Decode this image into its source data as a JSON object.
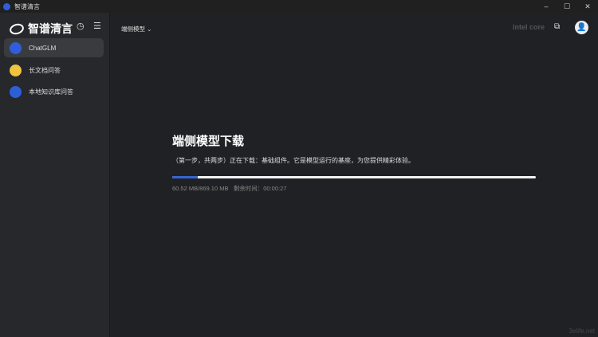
{
  "window": {
    "title": "智谱清言",
    "controls": {
      "minimize": "–",
      "maximize": "☐",
      "close": "✕"
    }
  },
  "sidebar": {
    "logo": "智谱清言",
    "items": [
      {
        "label": "ChatGLM",
        "color": "#2f5fd8",
        "active": true
      },
      {
        "label": "长文档问答",
        "color": "#f0c33c",
        "active": false
      },
      {
        "label": "本地知识库问答",
        "color": "#2f5fd8",
        "active": false
      }
    ]
  },
  "header": {
    "model_selector": "端侧模型",
    "brand": "intel core"
  },
  "download": {
    "title": "端侧模型下载",
    "description": "（第一步，共两步）正在下载：基础组件。它是模型运行的基座，为您提供精彩体验。",
    "downloaded": "60.52 MB/869.10 MB",
    "remaining_label": "剩余时间：",
    "remaining": "00:00:27",
    "progress_percent": 7,
    "accent": "#3566d6"
  },
  "watermark": "3elife.net"
}
